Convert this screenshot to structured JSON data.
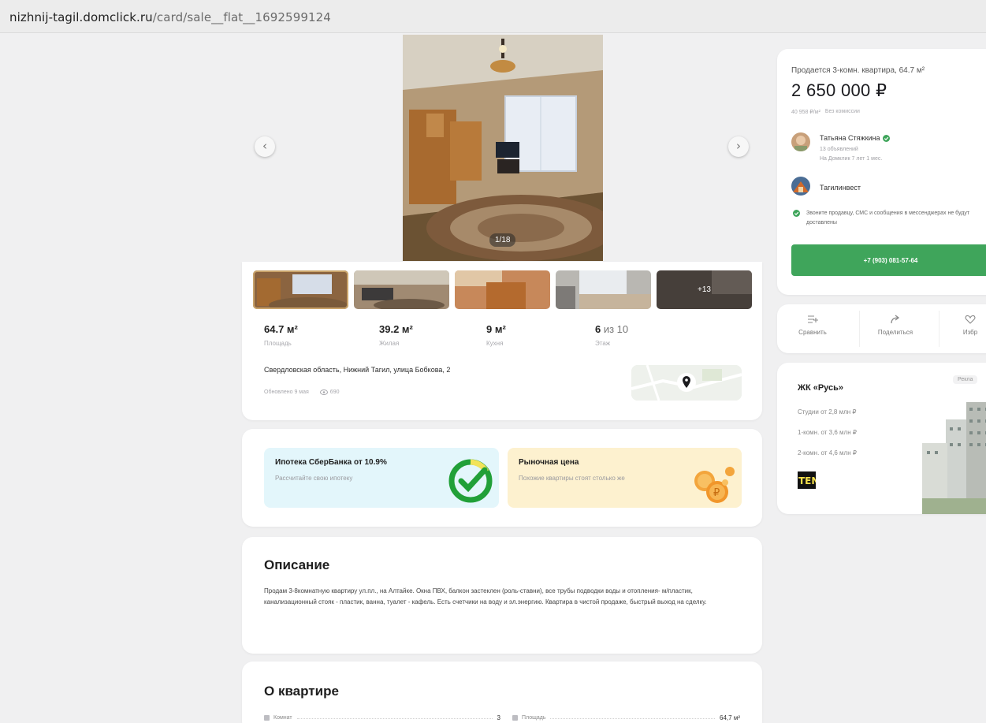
{
  "browser": {
    "domain": "nizhnij-tagil.domclick.ru",
    "path": "/card/sale__flat__1692599124"
  },
  "gallery": {
    "counter": "1/18",
    "prev_icon": "chevron-left-icon",
    "next_icon": "chevron-right-icon",
    "more_photos": "+13"
  },
  "stats": [
    {
      "value": "64.7 м²",
      "label": "Площадь"
    },
    {
      "value": "39.2 м²",
      "label": "Жилая"
    },
    {
      "value": "9 м²",
      "label": "Кухня"
    },
    {
      "value": "6",
      "of": " из 10",
      "label": "Этаж"
    }
  ],
  "address": "Свердловская область, Нижний Тагил, улица Бобкова, 2",
  "meta": {
    "updated": "Обновлено 9 мая",
    "views": "690"
  },
  "promos": {
    "sber": {
      "title": "Ипотека СберБанка от 10.9%",
      "subtitle": "Рассчитайте свою ипотеку"
    },
    "market": {
      "title": "Рыночная цена",
      "subtitle": "Похожие квартиры стоят столько же"
    }
  },
  "description": {
    "heading": "Описание",
    "text": "Продам 3-8комнатную квартиру ул.пл., на Алтайке. Окна ПВХ, балкон застеклен (роль-ставни), все трубы подводки воды и отопления- м/пластик, канализационный стояк - пластик, ванна, туалет - кафель. Есть счетчики на воду и эл.энергию. Квартира в чистой продаже, быстрый выход на сделку."
  },
  "apartment": {
    "heading": "О квартире",
    "rows": [
      {
        "label": "Комнат",
        "value": "3"
      },
      {
        "label": "Площадь",
        "value": "64,7 м²"
      }
    ]
  },
  "offer": {
    "title": "Продается 3-комн. квартира, 64.7 м²",
    "price": "2 650 000 ₽",
    "per_meter": "40 958 ₽/м²",
    "commission": "Без комиссии",
    "seller_name": "Татьяна Стяжкина",
    "seller_ads": "13 объявлений",
    "seller_since": "На Домклик 7 лет 1 мес.",
    "agency": "Тагилинвест",
    "notice": "Звоните продавцу, СМС и сообщения в мессенджерах не будут доставлены",
    "phone": "+7 (903) 081-57-64"
  },
  "actions": {
    "compare": "Сравнить",
    "share": "Поделиться",
    "favorite": "Избр"
  },
  "ad": {
    "tag": "Рекла",
    "title": "ЖК «Русь»",
    "rows": [
      "Студии от 2,8 млн ₽",
      "1-комн. от 3,6 млн ₽",
      "2-комн. от 4,6 млн ₽"
    ],
    "logo": "TEN"
  },
  "colors": {
    "accent_green": "#3fa55b",
    "sber_bg": "#e3f6fb",
    "market_bg": "#fdf1cf"
  }
}
